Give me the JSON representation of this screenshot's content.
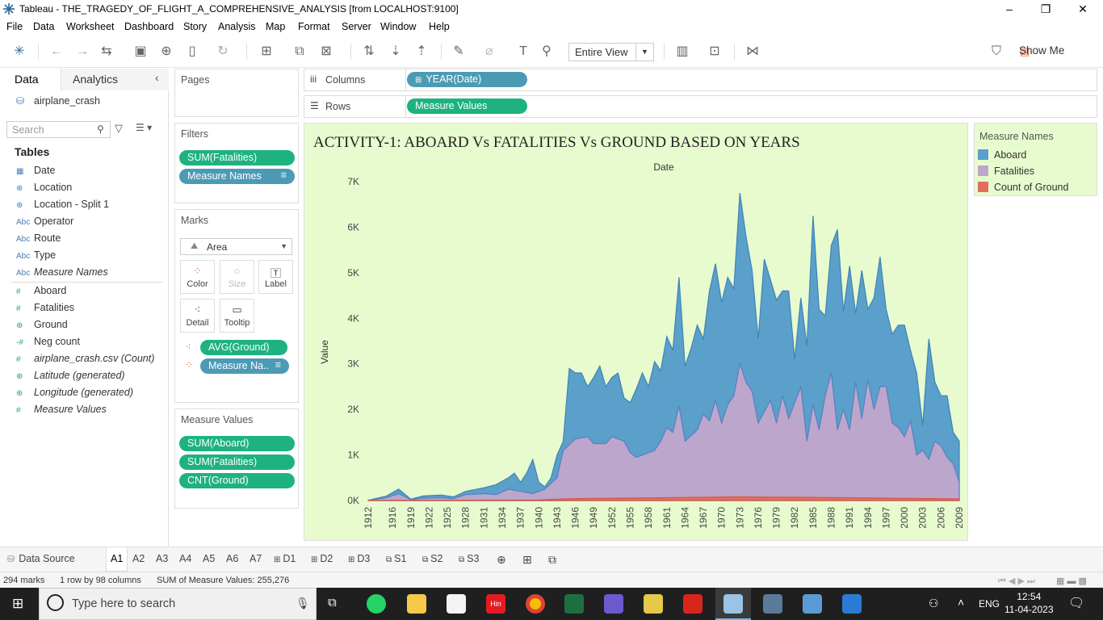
{
  "window": {
    "title": "Tableau - THE_TRAGEDY_OF_FLIGHT_A_COMPREHENSIVE_ANALYSIS [from LOCALHOST:9100]"
  },
  "menu": [
    "File",
    "Data",
    "Worksheet",
    "Dashboard",
    "Story",
    "Analysis",
    "Map",
    "Format",
    "Server",
    "Window",
    "Help"
  ],
  "toolbar": {
    "fit_mode": "Entire View",
    "show_me": "Show Me"
  },
  "data_pane": {
    "tab_data": "Data",
    "tab_analytics": "Analytics",
    "datasource": "airplane_crash",
    "search_placeholder": "Search",
    "tables_header": "Tables",
    "dimensions": [
      {
        "icon": "date-icon",
        "label": "Date"
      },
      {
        "icon": "globe-icon",
        "label": "Location"
      },
      {
        "icon": "globe-icon",
        "label": "Location - Split 1"
      },
      {
        "icon": "abc-icon",
        "label": "Operator"
      },
      {
        "icon": "abc-icon",
        "label": "Route"
      },
      {
        "icon": "abc-icon",
        "label": "Type"
      },
      {
        "icon": "abc-icon",
        "label": "Measure Names"
      }
    ],
    "measures": [
      {
        "icon": "number-icon",
        "label": "Aboard"
      },
      {
        "icon": "number-icon",
        "label": "Fatalities"
      },
      {
        "icon": "globe-icon",
        "label": "Ground"
      },
      {
        "icon": "number-icon",
        "label": "Neg count"
      },
      {
        "icon": "number-icon",
        "label": "airplane_crash.csv (Count)"
      },
      {
        "icon": "globe-icon",
        "label": "Latitude (generated)"
      },
      {
        "icon": "globe-icon",
        "label": "Longitude (generated)"
      },
      {
        "icon": "number-icon",
        "label": "Measure Values"
      }
    ]
  },
  "pages_card": {
    "header": "Pages"
  },
  "filters_card": {
    "header": "Filters",
    "pills": [
      "SUM(Fatalities)",
      "Measure Names"
    ]
  },
  "marks_card": {
    "header": "Marks",
    "type": "Area",
    "buttons": [
      "Color",
      "Size",
      "Label",
      "Detail",
      "Tooltip"
    ],
    "pills": [
      "AVG(Ground)",
      "Measure Na.."
    ]
  },
  "measure_values_card": {
    "header": "Measure Values",
    "pills": [
      "SUM(Aboard)",
      "SUM(Fatalities)",
      "CNT(Ground)"
    ]
  },
  "shelves": {
    "columns_label": "Columns",
    "columns_pill": "YEAR(Date)",
    "rows_label": "Rows",
    "rows_pill": "Measure Values"
  },
  "legend": {
    "header": "Measure Names",
    "items": [
      {
        "label": "Aboard",
        "color": "#5b9fcb"
      },
      {
        "label": "Fatalities",
        "color": "#bda6cc"
      },
      {
        "label": "Count of Ground",
        "color": "#e0705d"
      }
    ]
  },
  "sheet_tabs": {
    "datasource": "Data Source",
    "tabs": [
      "A1",
      "A2",
      "A3",
      "A4",
      "A5",
      "A6",
      "A7",
      "D1",
      "D2",
      "D3",
      "S1",
      "S2",
      "S3"
    ]
  },
  "status": {
    "marks": "294 marks",
    "dims": "1 row by 98 columns",
    "sum": "SUM of Measure Values: 255,276"
  },
  "taskbar": {
    "search_placeholder": "Type here to search",
    "lang": "ENG",
    "time": "12:54",
    "date": "11-04-2023",
    "app_label": "Hin"
  },
  "chart_data": {
    "type": "area",
    "title": "ACTIVITY-1: ABOARD Vs FATALITIES Vs GROUND BASED ON YEARS",
    "xlabel": "Date",
    "ylabel": "Value",
    "yticks": [
      "0K",
      "1K",
      "2K",
      "3K",
      "4K",
      "5K",
      "6K",
      "7K"
    ],
    "ylim": [
      0,
      7000
    ],
    "xlim": [
      1912,
      2009
    ],
    "xticks": [
      1912,
      1916,
      1919,
      1922,
      1925,
      1928,
      1931,
      1934,
      1937,
      1940,
      1943,
      1946,
      1949,
      1952,
      1955,
      1958,
      1961,
      1964,
      1967,
      1970,
      1973,
      1976,
      1979,
      1982,
      1985,
      1988,
      1991,
      1994,
      1997,
      2000,
      2003,
      2006,
      2009
    ],
    "stacked": true,
    "series": [
      {
        "name": "Count of Ground",
        "color": "#e0705d",
        "points": [
          [
            1912,
            2
          ],
          [
            1940,
            10
          ],
          [
            1945,
            40
          ],
          [
            1960,
            60
          ],
          [
            1972,
            80
          ],
          [
            1985,
            70
          ],
          [
            1995,
            55
          ],
          [
            2009,
            35
          ]
        ]
      },
      {
        "name": "Fatalities",
        "color": "#bda6cc",
        "points": [
          [
            1912,
            5
          ],
          [
            1915,
            60
          ],
          [
            1917,
            150
          ],
          [
            1919,
            20
          ],
          [
            1921,
            50
          ],
          [
            1924,
            60
          ],
          [
            1926,
            40
          ],
          [
            1928,
            130
          ],
          [
            1931,
            150
          ],
          [
            1933,
            130
          ],
          [
            1935,
            250
          ],
          [
            1937,
            200
          ],
          [
            1939,
            150
          ],
          [
            1941,
            250
          ],
          [
            1943,
            500
          ],
          [
            1944,
            1100
          ],
          [
            1946,
            1350
          ],
          [
            1948,
            1400
          ],
          [
            1949,
            1250
          ],
          [
            1951,
            1250
          ],
          [
            1952,
            1400
          ],
          [
            1954,
            1300
          ],
          [
            1955,
            1050
          ],
          [
            1956,
            950
          ],
          [
            1958,
            1050
          ],
          [
            1959,
            1100
          ],
          [
            1960,
            1300
          ],
          [
            1961,
            1600
          ],
          [
            1962,
            1500
          ],
          [
            1963,
            2080
          ],
          [
            1964,
            1300
          ],
          [
            1966,
            1550
          ],
          [
            1967,
            1900
          ],
          [
            1968,
            1750
          ],
          [
            1969,
            2200
          ],
          [
            1970,
            1700
          ],
          [
            1971,
            2100
          ],
          [
            1972,
            2300
          ],
          [
            1973,
            3000
          ],
          [
            1974,
            2600
          ],
          [
            1975,
            2400
          ],
          [
            1976,
            1700
          ],
          [
            1978,
            2200
          ],
          [
            1979,
            1700
          ],
          [
            1980,
            2300
          ],
          [
            1981,
            1800
          ],
          [
            1983,
            2500
          ],
          [
            1984,
            1300
          ],
          [
            1985,
            2100
          ],
          [
            1986,
            1550
          ],
          [
            1987,
            2300
          ],
          [
            1988,
            2800
          ],
          [
            1989,
            1550
          ],
          [
            1990,
            2000
          ],
          [
            1991,
            1550
          ],
          [
            1992,
            2600
          ],
          [
            1993,
            1800
          ],
          [
            1994,
            2650
          ],
          [
            1995,
            2000
          ],
          [
            1996,
            2500
          ],
          [
            1997,
            2500
          ],
          [
            1998,
            1700
          ],
          [
            1999,
            1600
          ],
          [
            2000,
            1400
          ],
          [
            2001,
            1750
          ],
          [
            2002,
            1000
          ],
          [
            2003,
            1100
          ],
          [
            2004,
            900
          ],
          [
            2005,
            1300
          ],
          [
            2006,
            1200
          ],
          [
            2007,
            950
          ],
          [
            2008,
            800
          ],
          [
            2009,
            400
          ]
        ]
      },
      {
        "name": "Aboard",
        "color": "#5b9fcb",
        "points": [
          [
            1912,
            5
          ],
          [
            1915,
            100
          ],
          [
            1917,
            250
          ],
          [
            1919,
            30
          ],
          [
            1921,
            100
          ],
          [
            1924,
            120
          ],
          [
            1926,
            80
          ],
          [
            1928,
            200
          ],
          [
            1931,
            280
          ],
          [
            1933,
            350
          ],
          [
            1935,
            500
          ],
          [
            1936,
            600
          ],
          [
            1937,
            400
          ],
          [
            1938,
            600
          ],
          [
            1939,
            900
          ],
          [
            1940,
            400
          ],
          [
            1941,
            300
          ],
          [
            1942,
            500
          ],
          [
            1943,
            1000
          ],
          [
            1944,
            1300
          ],
          [
            1945,
            2900
          ],
          [
            1946,
            2800
          ],
          [
            1947,
            2800
          ],
          [
            1948,
            2500
          ],
          [
            1949,
            2700
          ],
          [
            1950,
            2950
          ],
          [
            1951,
            2500
          ],
          [
            1952,
            2700
          ],
          [
            1953,
            2800
          ],
          [
            1954,
            2250
          ],
          [
            1955,
            2150
          ],
          [
            1956,
            2450
          ],
          [
            1957,
            2800
          ],
          [
            1958,
            2500
          ],
          [
            1959,
            3050
          ],
          [
            1960,
            2850
          ],
          [
            1961,
            3600
          ],
          [
            1962,
            3300
          ],
          [
            1963,
            4900
          ],
          [
            1964,
            2950
          ],
          [
            1965,
            3350
          ],
          [
            1966,
            3850
          ],
          [
            1967,
            3550
          ],
          [
            1968,
            4600
          ],
          [
            1969,
            5200
          ],
          [
            1970,
            4350
          ],
          [
            1971,
            4900
          ],
          [
            1972,
            4650
          ],
          [
            1973,
            6750
          ],
          [
            1974,
            5800
          ],
          [
            1975,
            5050
          ],
          [
            1976,
            3550
          ],
          [
            1977,
            5300
          ],
          [
            1978,
            4850
          ],
          [
            1979,
            4400
          ],
          [
            1980,
            4600
          ],
          [
            1981,
            4600
          ],
          [
            1982,
            3100
          ],
          [
            1983,
            4450
          ],
          [
            1984,
            3400
          ],
          [
            1985,
            6250
          ],
          [
            1986,
            4200
          ],
          [
            1987,
            4050
          ],
          [
            1988,
            5600
          ],
          [
            1989,
            5950
          ],
          [
            1990,
            4150
          ],
          [
            1991,
            5150
          ],
          [
            1992,
            4100
          ],
          [
            1993,
            5050
          ],
          [
            1994,
            4200
          ],
          [
            1995,
            4450
          ],
          [
            1996,
            5350
          ],
          [
            1997,
            4200
          ],
          [
            1998,
            3650
          ],
          [
            1999,
            3850
          ],
          [
            2000,
            3850
          ],
          [
            2001,
            3300
          ],
          [
            2002,
            2800
          ],
          [
            2003,
            1650
          ],
          [
            2004,
            3550
          ],
          [
            2005,
            2600
          ],
          [
            2006,
            2300
          ],
          [
            2007,
            2300
          ],
          [
            2008,
            1500
          ],
          [
            2009,
            1300
          ]
        ]
      }
    ]
  }
}
